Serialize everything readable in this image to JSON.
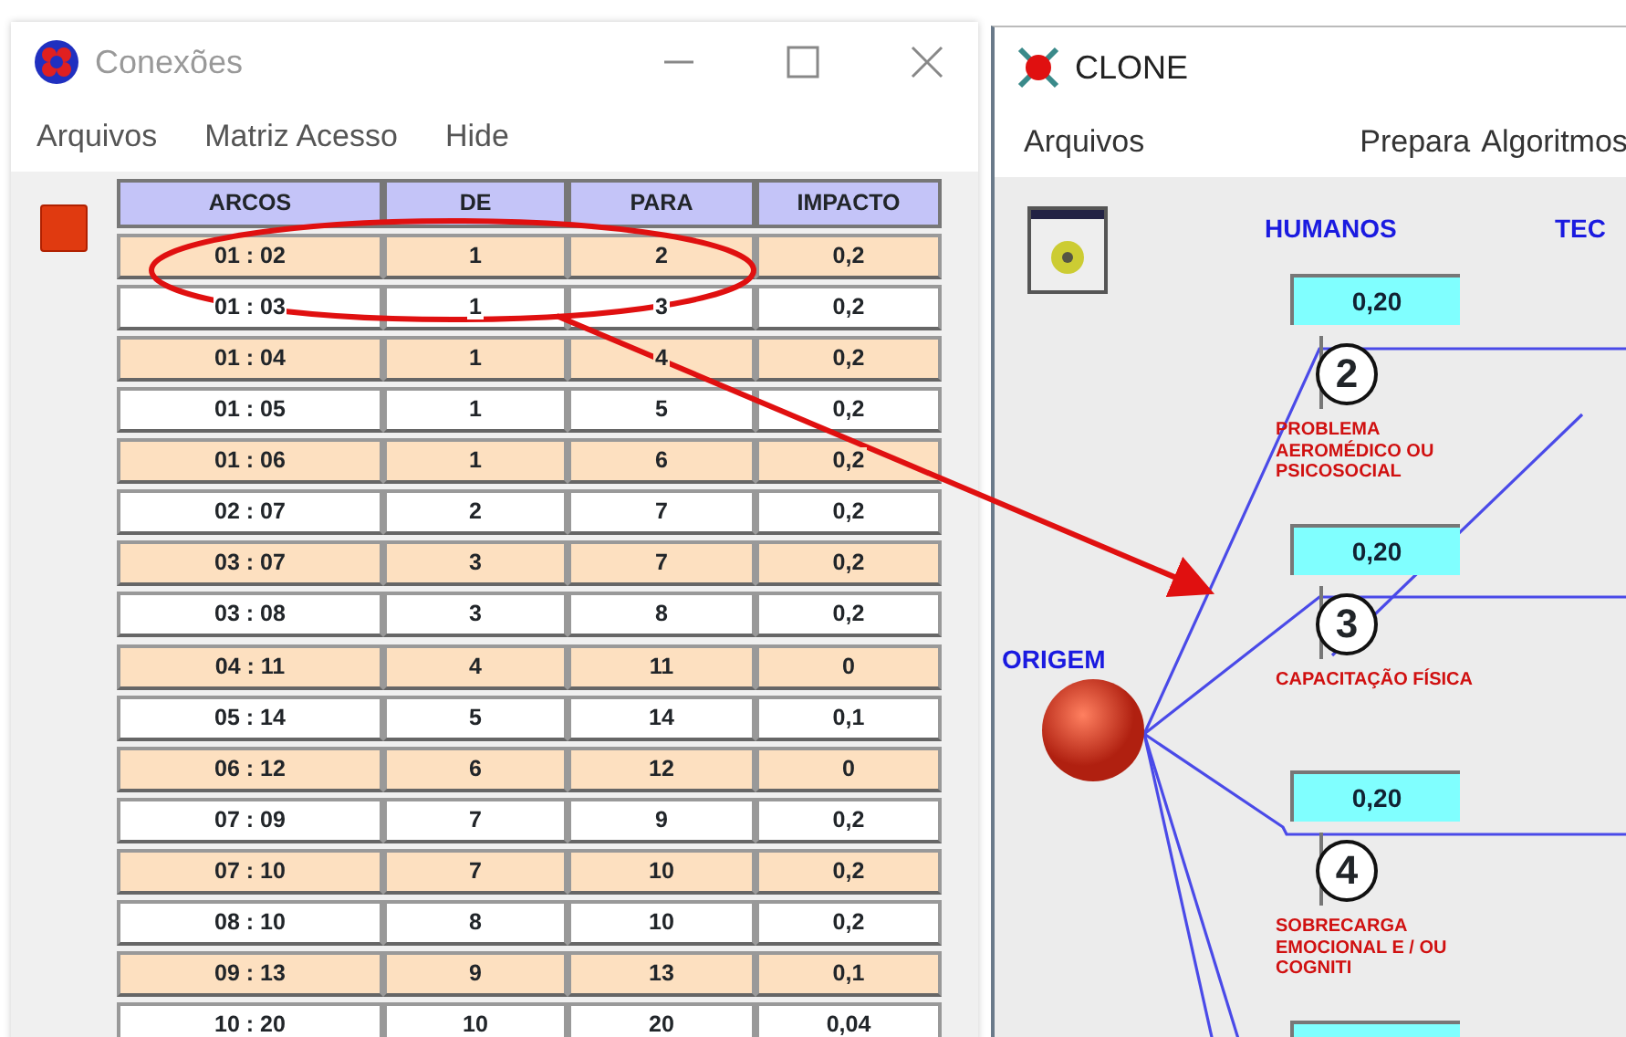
{
  "connections_window": {
    "title": "Conexões",
    "menu": [
      "Arquivos",
      "Matriz Acesso",
      "Hide"
    ],
    "table": {
      "columns": [
        "ARCOS",
        "DE",
        "PARA",
        "IMPACTO"
      ],
      "rows": [
        [
          "01 : 02",
          "1",
          "2",
          "0,2"
        ],
        [
          "01 : 03",
          "1",
          "3",
          "0,2"
        ],
        [
          "01 : 04",
          "1",
          "4",
          "0,2"
        ],
        [
          "01 : 05",
          "1",
          "5",
          "0,2"
        ],
        [
          "01 : 06",
          "1",
          "6",
          "0,2"
        ],
        [
          "02 : 07",
          "2",
          "7",
          "0,2"
        ],
        [
          "03 : 07",
          "3",
          "7",
          "0,2"
        ],
        [
          "03 : 08",
          "3",
          "8",
          "0,2"
        ],
        [
          "04 : 11",
          "4",
          "11",
          "0"
        ],
        [
          "05 : 14",
          "5",
          "14",
          "0,1"
        ],
        [
          "06 : 12",
          "6",
          "12",
          "0"
        ],
        [
          "07 : 09",
          "7",
          "9",
          "0,2"
        ],
        [
          "07 : 10",
          "7",
          "10",
          "0,2"
        ],
        [
          "08 : 10",
          "8",
          "10",
          "0,2"
        ],
        [
          "09 : 13",
          "9",
          "13",
          "0,1"
        ],
        [
          "10 : 20",
          "10",
          "20",
          "0,04"
        ]
      ]
    }
  },
  "clone_window": {
    "title": "CLONE",
    "menu": [
      "Arquivos",
      "Prepara",
      "Algoritmos"
    ],
    "group_headings": [
      "HUMANOS",
      "TEC"
    ],
    "origin_label": "ORIGEM",
    "nodes": [
      {
        "value": "0,20",
        "number": "2",
        "label": "PROBLEMA AEROMÉDICO OU PSICOSOCIAL"
      },
      {
        "value": "0,20",
        "number": "3",
        "label": "CAPACITAÇÃO FÍSICA"
      },
      {
        "value": "0,20",
        "number": "4",
        "label": "SOBRECARGA EMOCIONAL E / OU COGNITI"
      }
    ]
  }
}
